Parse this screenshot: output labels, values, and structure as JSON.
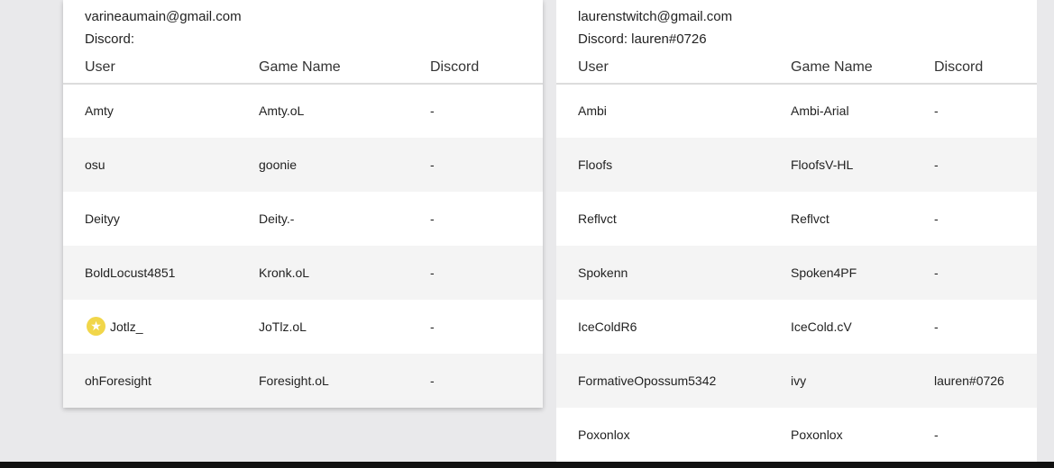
{
  "columns": {
    "user": "User",
    "game_name": "Game Name",
    "discord": "Discord"
  },
  "left_team": {
    "email": "varineaumain@gmail.com",
    "discord": "Discord:",
    "rows": [
      {
        "user": "Amty",
        "game": "Amty.oL",
        "discord": "-"
      },
      {
        "user": "osu",
        "game": "goonie",
        "discord": "-"
      },
      {
        "user": "Deityy",
        "game": "Deity.-",
        "discord": "-"
      },
      {
        "user": "BoldLocust4851",
        "game": "Kronk.oL",
        "discord": "-"
      },
      {
        "user": "Jotlz_",
        "game": "JoTlz.oL",
        "discord": "-"
      },
      {
        "user": "ohForesight",
        "game": "Foresight.oL",
        "discord": "-"
      }
    ]
  },
  "right_team": {
    "email": "laurenstwitch@gmail.com",
    "discord": "Discord: lauren#0726",
    "rows": [
      {
        "user": "Ambi",
        "game": "Ambi-Arial",
        "discord": "-"
      },
      {
        "user": "Floofs",
        "game": "FloofsV-HL",
        "discord": "-"
      },
      {
        "user": "Reflvct",
        "game": "Reflvct",
        "discord": "-"
      },
      {
        "user": "Spokenn",
        "game": "Spoken4PF",
        "discord": "-"
      },
      {
        "user": "IceColdR6",
        "game": "IceCold.cV",
        "discord": "-"
      },
      {
        "user": "FormativeOpossum5342",
        "game": "ivy",
        "discord": "lauren#0726"
      },
      {
        "user": "Poxonlox",
        "game": "Poxonlox",
        "discord": "-"
      }
    ]
  },
  "icons": {
    "captain": "star-icon"
  },
  "colors": {
    "star": "#f1d64a"
  }
}
